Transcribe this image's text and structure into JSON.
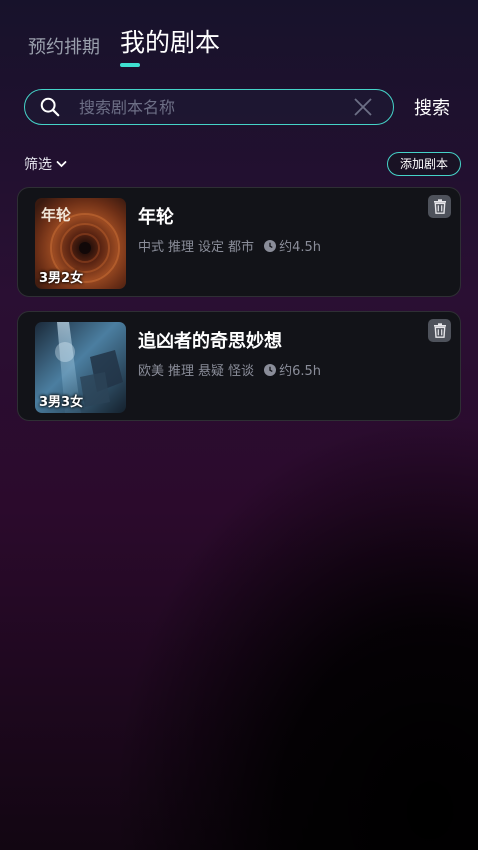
{
  "tabs": [
    {
      "label": "预约排期",
      "active": false
    },
    {
      "label": "我的剧本",
      "active": true
    }
  ],
  "search": {
    "placeholder": "搜索剧本名称",
    "value": "",
    "button_label": "搜索"
  },
  "filter": {
    "label": "筛选"
  },
  "add_button": {
    "label": "添加剧本"
  },
  "scripts": [
    {
      "title": "年轮",
      "tags": [
        "中式",
        "推理",
        "设定",
        "都市"
      ],
      "duration": "约4.5h",
      "players": "3男2女",
      "cover_text": "年轮"
    },
    {
      "title": "追凶者的奇思妙想",
      "tags": [
        "欧美",
        "推理",
        "悬疑",
        "怪谈"
      ],
      "duration": "约6.5h",
      "players": "3男3女"
    }
  ],
  "colors": {
    "accent": "#45d3c8",
    "tab_indicator": "#3fe0d0"
  }
}
